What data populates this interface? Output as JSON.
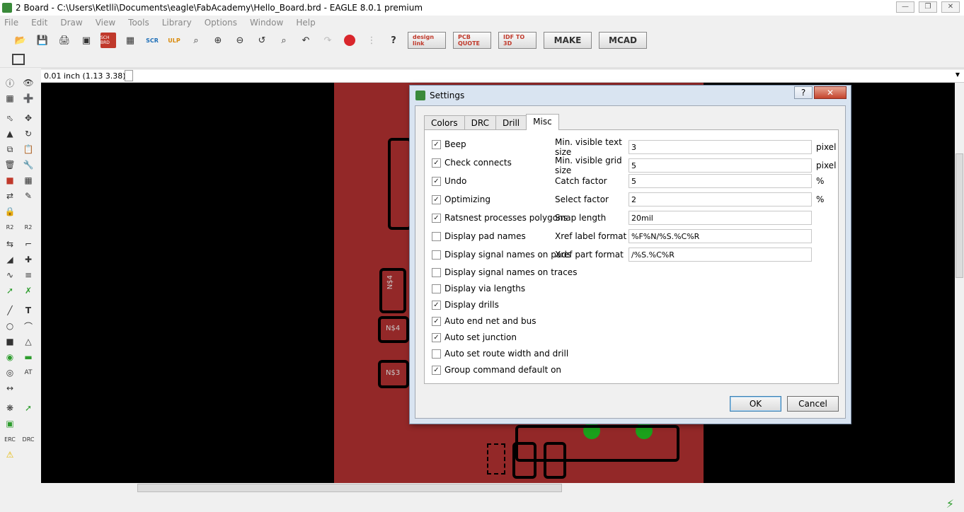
{
  "window": {
    "title": "2 Board - C:\\Users\\Ketlli\\Documents\\eagle\\FabAcademy\\Hello_Board.brd - EAGLE 8.0.1 premium",
    "app_icon": "eagle-icon",
    "controls": [
      "minimize-icon",
      "restore-icon",
      "close-icon"
    ]
  },
  "menu": [
    "File",
    "Edit",
    "Draw",
    "View",
    "Tools",
    "Library",
    "Options",
    "Window",
    "Help"
  ],
  "toolbar": {
    "sch_brd": "SCH\nBRD",
    "scr": "SCR",
    "ulp": "ULP",
    "designlink": "design link",
    "pcb_quote": "PCB QUOTE",
    "idf": "IDF TO 3D",
    "make": "MAKE",
    "mcad": "MCAD",
    "help": "?"
  },
  "coordinates": "0.01 inch (1.13 3.38)",
  "board": {
    "pad_labels": [
      "N$4",
      "N$4",
      "N$3"
    ],
    "colors": {
      "board": "#932828",
      "background": "#000000",
      "led": "#1ba01b"
    }
  },
  "dialog": {
    "title": "Settings",
    "help_label": "?",
    "tabs": [
      {
        "label": "Colors",
        "active": false
      },
      {
        "label": "DRC",
        "active": false
      },
      {
        "label": "Drill",
        "active": false
      },
      {
        "label": "Misc",
        "active": true
      }
    ],
    "checkboxes": [
      {
        "label": "Beep",
        "checked": true
      },
      {
        "label": "Check connects",
        "checked": true
      },
      {
        "label": "Undo",
        "checked": true
      },
      {
        "label": "Optimizing",
        "checked": true
      },
      {
        "label": "Ratsnest processes polygons",
        "checked": true
      },
      {
        "label": "Display pad names",
        "checked": false
      },
      {
        "label": "Display signal names on pads",
        "checked": false
      },
      {
        "label": "Display signal names on traces",
        "checked": false
      },
      {
        "label": "Display via lengths",
        "checked": false
      },
      {
        "label": "Display drills",
        "checked": true
      },
      {
        "label": "Auto end net and bus",
        "checked": true
      },
      {
        "label": "Auto set junction",
        "checked": true
      },
      {
        "label": "Auto set route width and drill",
        "checked": false
      },
      {
        "label": "Group command default on",
        "checked": true
      }
    ],
    "fields": [
      {
        "label": "Min. visible text size",
        "value": "3",
        "unit": "pixel"
      },
      {
        "label": "Min. visible grid size",
        "value": "5",
        "unit": "pixel"
      },
      {
        "label": "Catch factor",
        "value": "5",
        "unit": "%"
      },
      {
        "label": "Select factor",
        "value": "2",
        "unit": "%"
      },
      {
        "label": "Snap length",
        "value": "20mil",
        "unit": ""
      },
      {
        "label": "Xref label format",
        "value": "%F%N/%S.%C%R",
        "unit": ""
      },
      {
        "label": "Xref part format",
        "value": "/%S.%C%R",
        "unit": ""
      }
    ],
    "ok_label": "OK",
    "cancel_label": "Cancel"
  }
}
